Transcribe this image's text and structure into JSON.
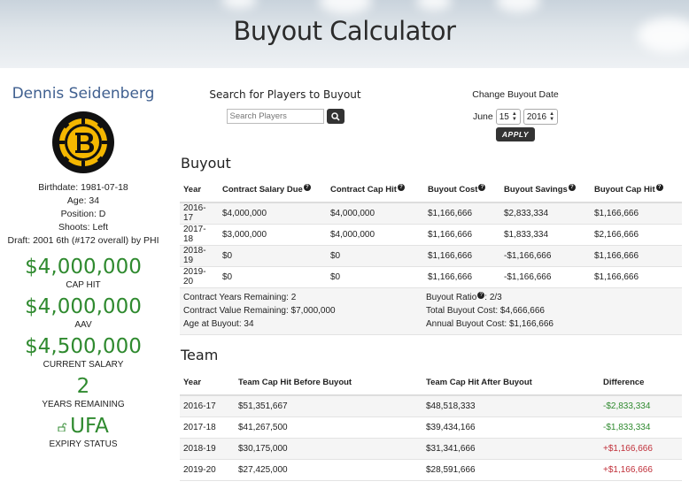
{
  "header": {
    "title": "Buyout Calculator"
  },
  "player": {
    "name": "Dennis Seidenberg",
    "logo": "bruins-logo",
    "info": [
      "Birthdate: 1981-07-18",
      "Age: 34",
      "Position: D",
      "Shoots: Left",
      "Draft: 2001 6th (#172 overall) by PHI"
    ],
    "stats": [
      {
        "value": "$4,000,000",
        "label": "CAP HIT"
      },
      {
        "value": "$4,000,000",
        "label": "AAV"
      },
      {
        "value": "$4,500,000",
        "label": "CURRENT SALARY"
      },
      {
        "value": "2",
        "label": "YEARS REMAINING"
      },
      {
        "value": "UFA",
        "label": "EXPIRY STATUS",
        "icon": "unlock-icon"
      }
    ]
  },
  "search": {
    "title": "Search for Players to Buyout",
    "placeholder": "Search Players",
    "button_icon": "search-icon"
  },
  "buyout_date": {
    "title": "Change Buyout Date",
    "month": "June",
    "day": "15",
    "year": "2016",
    "apply_label": "APPLY"
  },
  "buyout": {
    "title": "Buyout",
    "headers": [
      "Year",
      "Contract Salary Due",
      "Contract Cap Hit",
      "Buyout Cost",
      "Buyout Savings",
      "Buyout Cap Hit"
    ],
    "rows": [
      [
        "2016-17",
        "$4,000,000",
        "$4,000,000",
        "$1,166,666",
        "$2,833,334",
        "$1,166,666"
      ],
      [
        "2017-18",
        "$3,000,000",
        "$4,000,000",
        "$1,166,666",
        "$1,833,334",
        "$2,166,666"
      ],
      [
        "2018-19",
        "$0",
        "$0",
        "$1,166,666",
        "-$1,166,666",
        "$1,166,666"
      ],
      [
        "2019-20",
        "$0",
        "$0",
        "$1,166,666",
        "-$1,166,666",
        "$1,166,666"
      ]
    ],
    "summary": {
      "contract_years_remaining": "Contract Years Remaining: 2",
      "contract_value_remaining": "Contract Value Remaining: $7,000,000",
      "age_at_buyout": "Age at Buyout: 34",
      "buyout_ratio_label": "Buyout Ratio",
      "buyout_ratio_value": ": 2/3",
      "total_buyout_cost": "Total Buyout Cost: $4,666,666",
      "annual_buyout_cost": "Annual Buyout Cost: $1,166,666"
    }
  },
  "team": {
    "title": "Team",
    "headers": [
      "Year",
      "Team Cap Hit Before Buyout",
      "Team Cap Hit After Buyout",
      "Difference"
    ],
    "rows": [
      [
        "2016-17",
        "$51,351,667",
        "$48,518,333",
        "-$2,833,334"
      ],
      [
        "2017-18",
        "$41,267,500",
        "$39,434,166",
        "-$1,833,334"
      ],
      [
        "2018-19",
        "$30,175,000",
        "$31,341,666",
        "+$1,166,666"
      ],
      [
        "2019-20",
        "$27,425,000",
        "$28,591,666",
        "+$1,166,666"
      ]
    ]
  },
  "colors": {
    "money_green": "#2f8a2f",
    "negative_red": "#c0303a",
    "name_blue": "#3f5f8f"
  }
}
